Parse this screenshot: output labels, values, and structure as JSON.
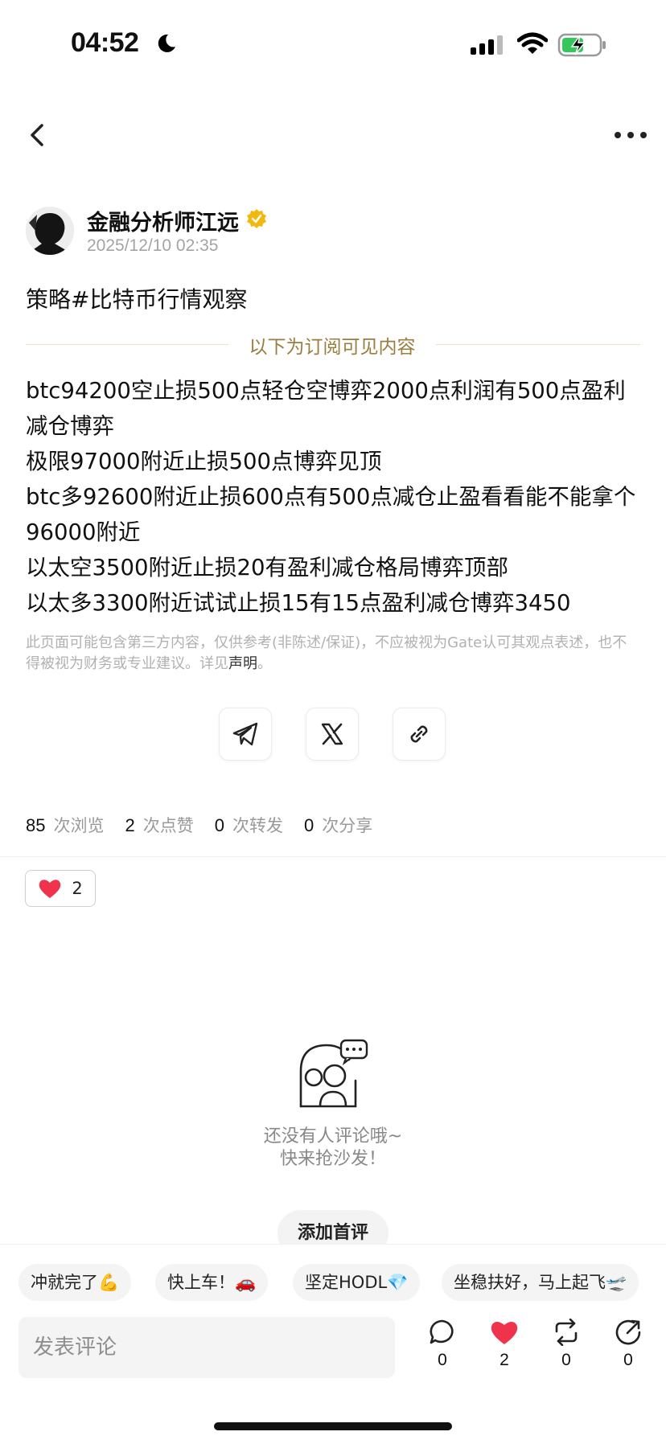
{
  "status_bar": {
    "time": "04:52"
  },
  "post": {
    "author": "金融分析师江远",
    "date": "2025/12/10 02:35",
    "topic": "策略#比特币行情观察",
    "subscription_divider": "以下为订阅可见内容",
    "content_lines": [
      "btc94200空止损500点轻仓空博弈2000点利润有500点盈利减仓博弈",
      "极限97000附近止损500点博弈见顶",
      "btc多92600附近止损600点有500点减仓止盈看看能不能拿个96000附近",
      "以太空3500附近止损20有盈利减仓格局博弈顶部",
      "以太多3300附近试试止损15有15点盈利减仓博弈3450"
    ],
    "disclaimer": "此页面可能包含第三方内容，仅供参考(非陈述/保证)，不应被视为Gate认可其观点表述，也不得被视为财务或专业建议。详见",
    "disclaimer_link": "声明",
    "disclaimer_end": "。"
  },
  "stats": {
    "views": "85",
    "views_label": "次浏览",
    "likes": "2",
    "likes_label": "次点赞",
    "reposts": "0",
    "reposts_label": "次转发",
    "shares": "0",
    "shares_label": "次分享"
  },
  "reaction": {
    "count": "2"
  },
  "comments_empty": {
    "line1": "还没有人评论哦~",
    "line2": "快来抢沙发！",
    "button": "添加首评"
  },
  "quick_replies": [
    "冲就完了💪",
    "快上车！🚗",
    "坚定HODL💎",
    "坐稳扶好，马上起飞🛫"
  ],
  "comment_box": {
    "placeholder": "发表评论"
  },
  "actions": {
    "comment": "0",
    "like": "2",
    "repost": "0",
    "share": "0"
  },
  "colors": {
    "accent_gold": "#9a7d3f",
    "heart_red": "#f0334d",
    "verified": "#f0b90b"
  }
}
